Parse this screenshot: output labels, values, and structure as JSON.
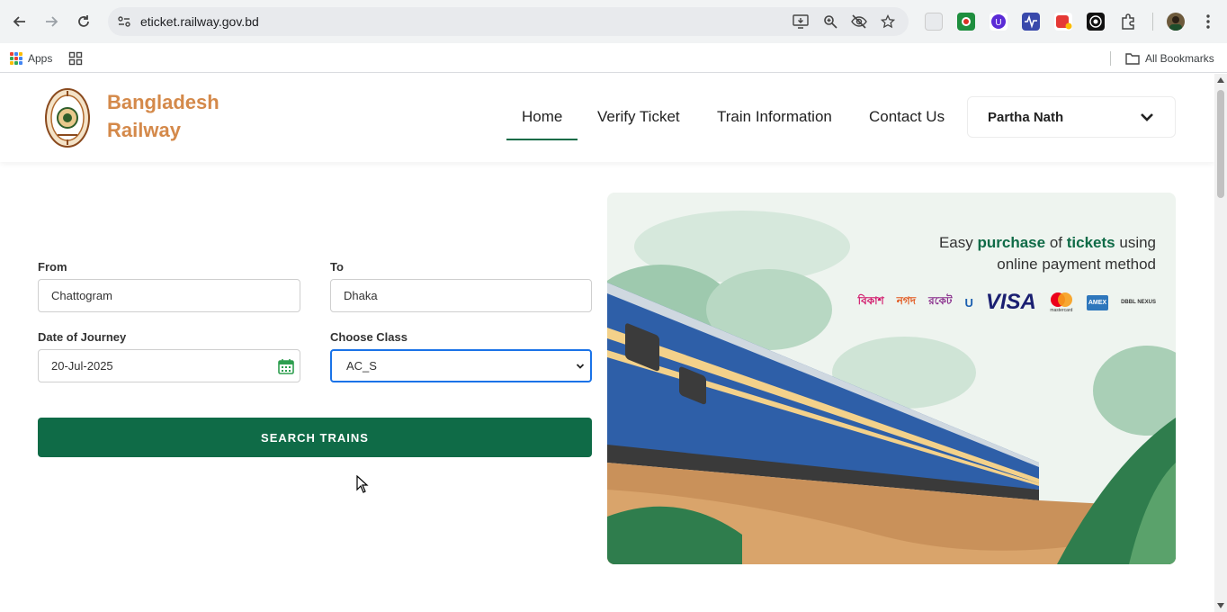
{
  "browser": {
    "url": "eticket.railway.gov.bd",
    "bookmarks": {
      "apps_label": "Apps",
      "all_bookmarks_label": "All Bookmarks"
    }
  },
  "site": {
    "brand_line1": "Bangladesh",
    "brand_line2": "Railway",
    "brand_color": "#d4894a",
    "accent_color": "#0f6b47",
    "nav": {
      "home": "Home",
      "verify": "Verify Ticket",
      "train_info": "Train Information",
      "contact": "Contact Us"
    },
    "user_name": "Partha Nath"
  },
  "search_form": {
    "from_label": "From",
    "from_value": "Chattogram",
    "to_label": "To",
    "to_value": "Dhaka",
    "date_label": "Date of Journey",
    "date_value": "20-Jul-2025",
    "class_label": "Choose Class",
    "class_value": "AC_S",
    "search_button": "SEARCH TRAINS"
  },
  "hero": {
    "text_easy": "Easy",
    "text_purchase": "purchase",
    "text_of": "of",
    "text_tickets": "tickets",
    "text_using": "using",
    "text_line2": "online payment method",
    "payment_logos": {
      "bkash": "বিকাশ",
      "nagad": "নগদ",
      "rocket": "রকেট",
      "upay": "U",
      "visa": "VISA",
      "mastercard": "mastercard",
      "amex": "AMEX",
      "dbbl": "DBBL NEXUS"
    }
  }
}
